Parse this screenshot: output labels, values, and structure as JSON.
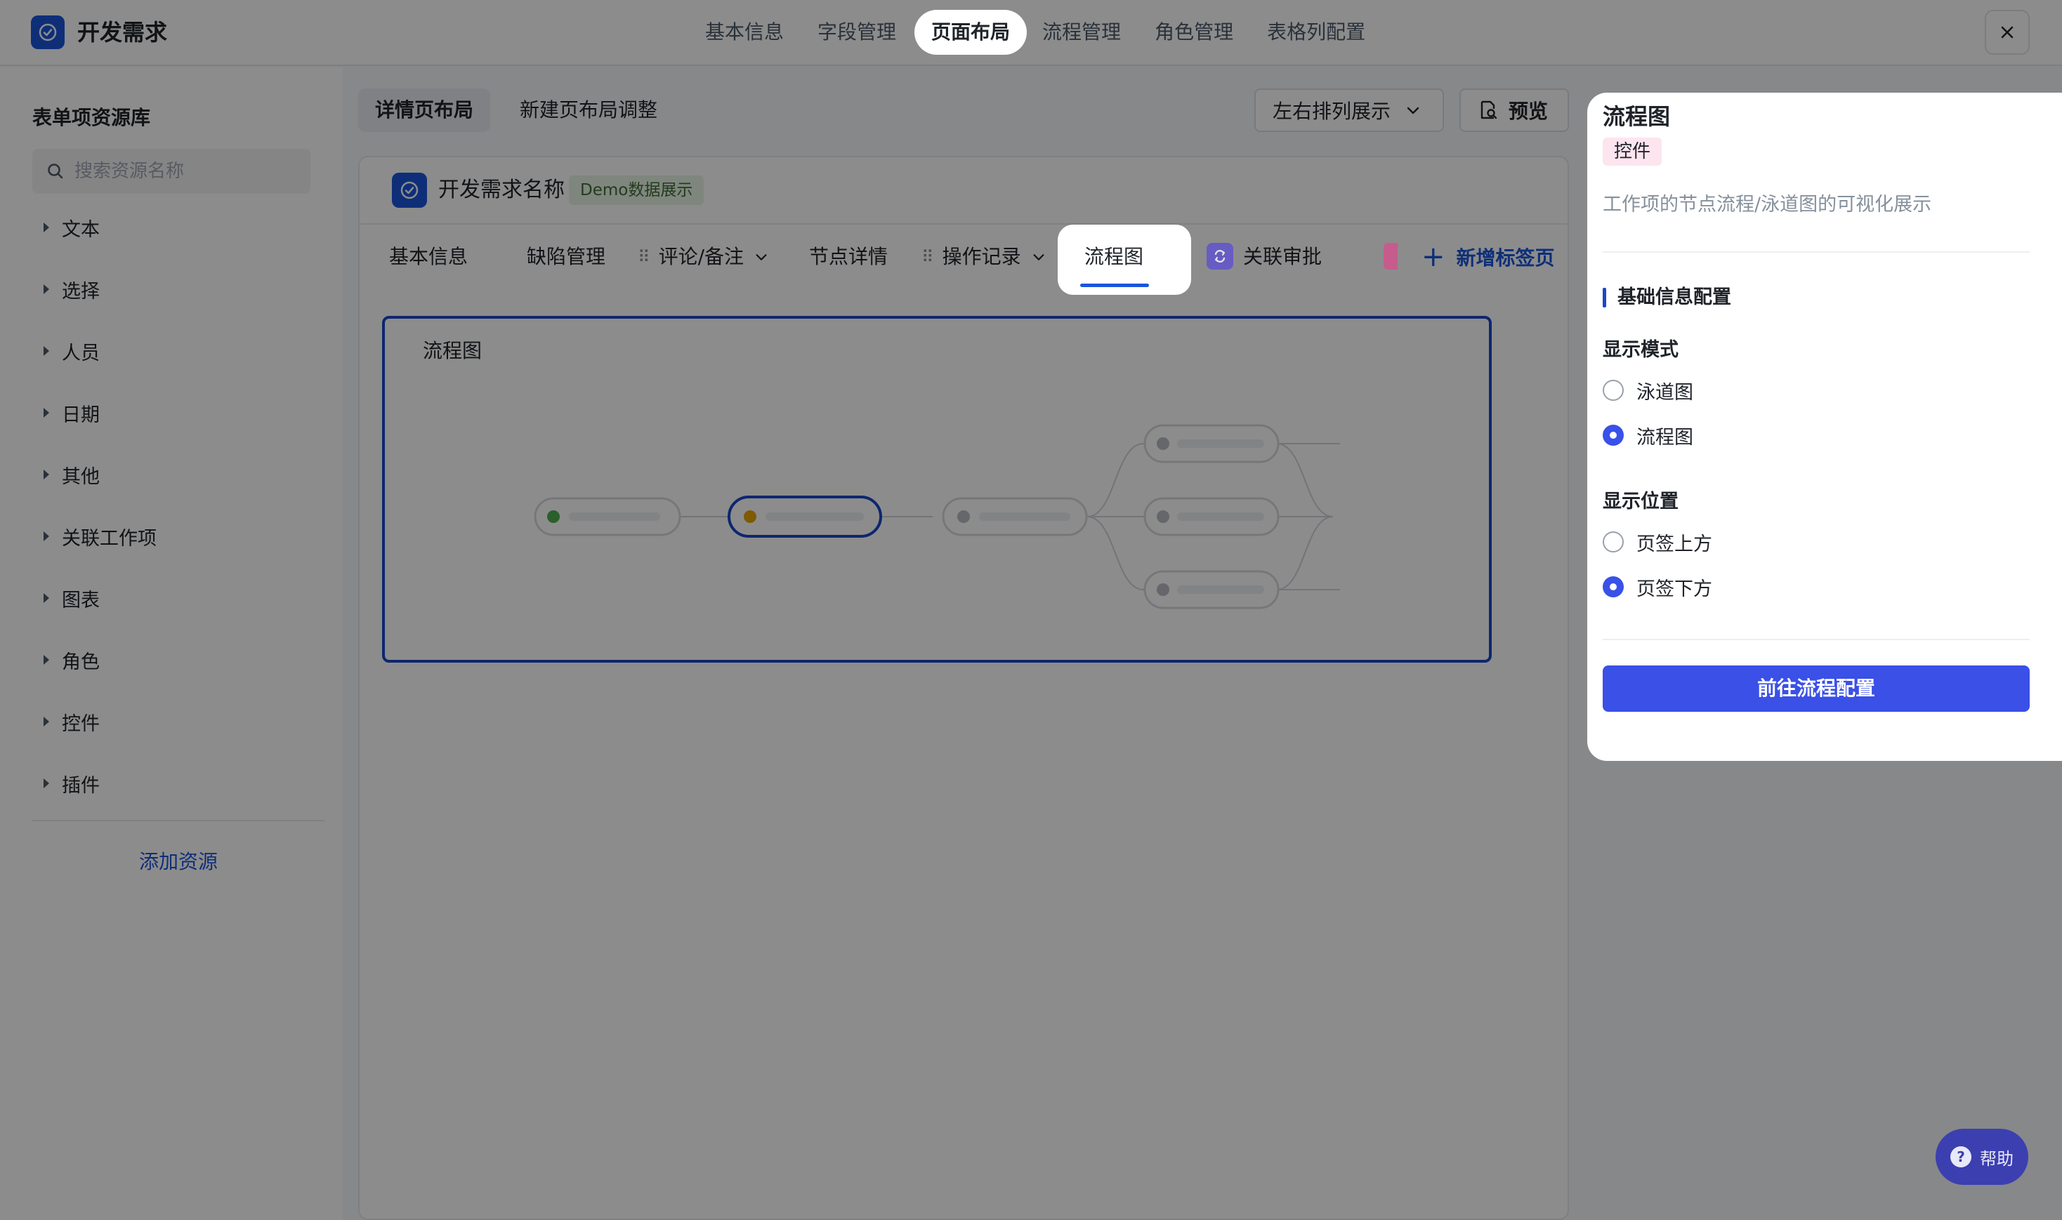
{
  "app": {
    "title": "开发需求"
  },
  "top_tabs": [
    "基本信息",
    "字段管理",
    "页面布局",
    "流程管理",
    "角色管理",
    "表格列配置"
  ],
  "active_top_tab": "页面布局",
  "left_panel": {
    "title": "表单项资源库",
    "search_placeholder": "搜索资源名称",
    "categories": [
      "文本",
      "选择",
      "人员",
      "日期",
      "其他",
      "关联工作项",
      "图表",
      "角色",
      "控件",
      "插件"
    ],
    "add_resource": "添加资源"
  },
  "sub_tabs": [
    "详情页布局",
    "新建页布局调整"
  ],
  "arrange": {
    "label": "左右排列展示"
  },
  "preview": {
    "label": "预览"
  },
  "card": {
    "title": "开发需求名称",
    "badge": "Demo数据展示",
    "tabs": [
      "基本信息",
      "缺陷管理",
      "评论/备注",
      "节点详情",
      "操作记录",
      "流程图",
      "关联审批"
    ],
    "active_tab": "流程图",
    "add_tab": "新增标签页",
    "flow_label": "流程图"
  },
  "right_panel": {
    "title": "流程图",
    "badge": "控件",
    "description": "工作项的节点流程/泳道图的可视化展示",
    "section": "基础信息配置",
    "display_mode": {
      "label": "显示模式",
      "options": [
        "泳道图",
        "流程图"
      ],
      "selected": "流程图"
    },
    "display_position": {
      "label": "显示位置",
      "options": [
        "页签上方",
        "页签下方"
      ],
      "selected": "页签下方"
    },
    "button": "前往流程配置"
  },
  "help": {
    "label": "帮助"
  },
  "colors": {
    "primary": "#1a56db",
    "button": "#3a50e6",
    "overlay": "rgba(0,0,0,0.45)",
    "badge_green_bg": "#e8f4e6",
    "badge_pink_bg": "#fde5ef"
  }
}
